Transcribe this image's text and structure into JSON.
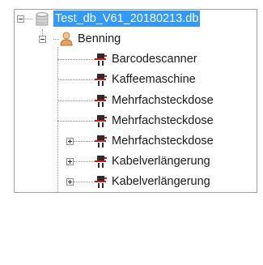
{
  "tree": {
    "root": {
      "label": "Test_db_V61_20180213.db",
      "icon": "database-icon",
      "expanded": true,
      "selected": true
    },
    "group": {
      "label": "Benning",
      "icon": "user-icon",
      "expanded": true
    },
    "items": [
      {
        "label": "Barcodescanner",
        "icon": "device-icon",
        "expander": "none"
      },
      {
        "label": "Kaffeemaschine",
        "icon": "device-icon",
        "expander": "none"
      },
      {
        "label": "Mehrfachsteckdose",
        "icon": "device-icon",
        "expander": "none"
      },
      {
        "label": "Mehrfachsteckdose",
        "icon": "device-icon",
        "expander": "none"
      },
      {
        "label": "Mehrfachsteckdose",
        "icon": "device-icon",
        "expander": "plus"
      },
      {
        "label": "Kabelverlängerung",
        "icon": "device-icon",
        "expander": "plus"
      },
      {
        "label": "Kabelverlängerung",
        "icon": "device-icon",
        "expander": "plus"
      }
    ],
    "colors": {
      "selection": "#3399ff",
      "plug_red": "#d11919",
      "plug_dark": "#2d2d2d"
    }
  }
}
